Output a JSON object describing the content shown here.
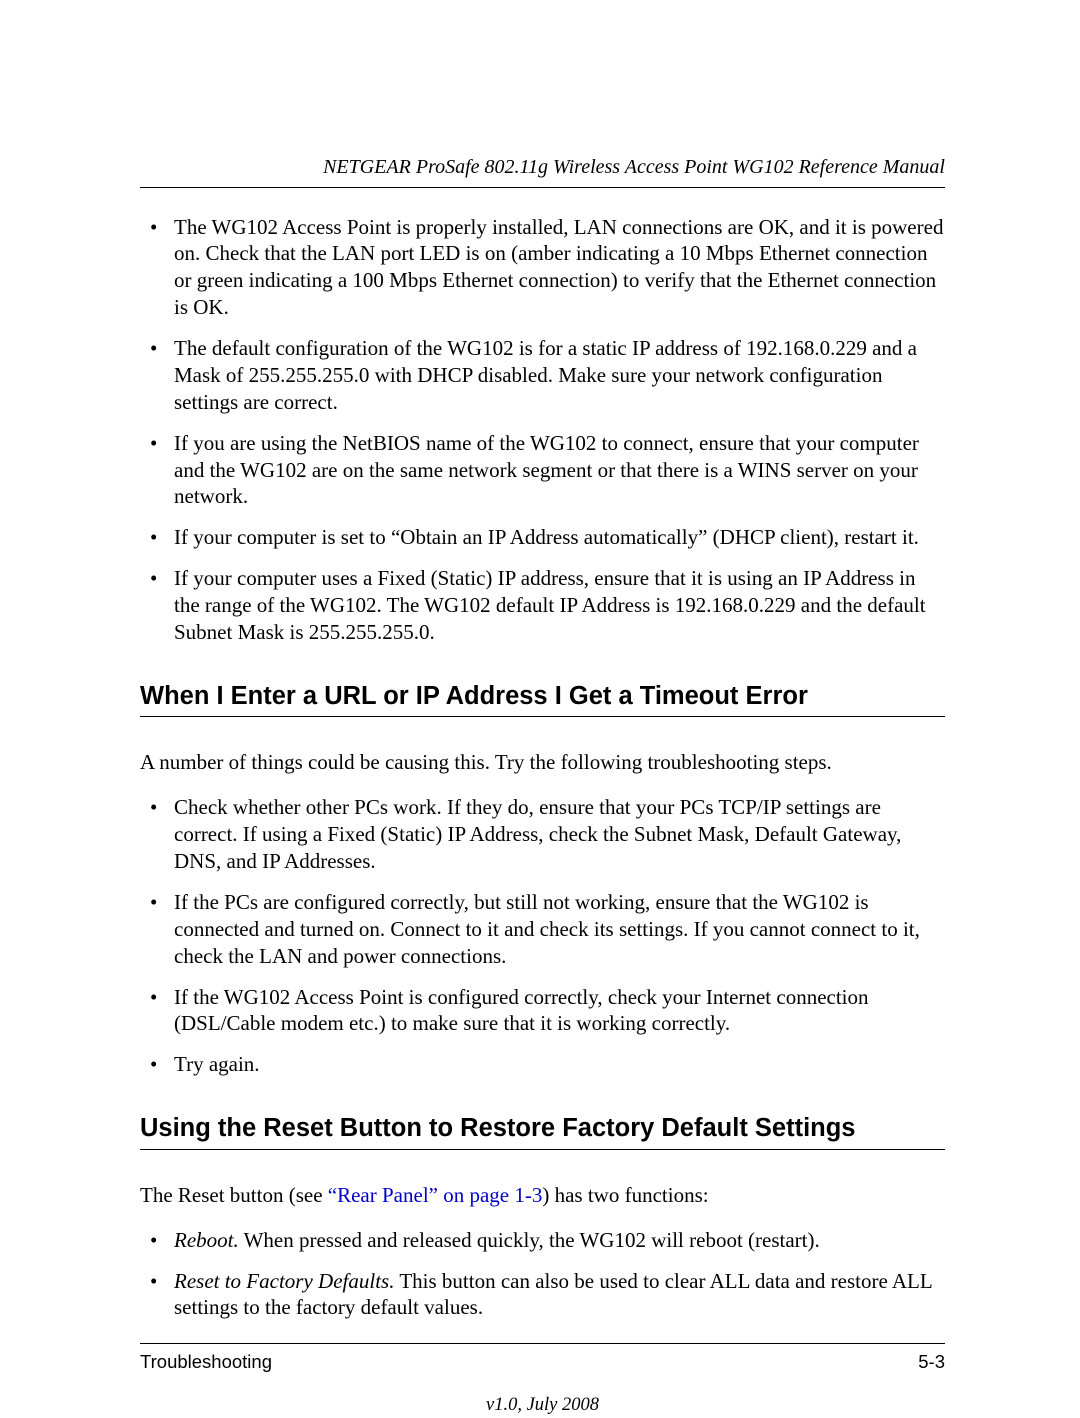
{
  "header": {
    "running_title": "NETGEAR ProSafe 802.11g Wireless Access Point WG102 Reference Manual"
  },
  "bullets_top": [
    "The WG102 Access Point is properly installed, LAN connections are OK, and it is powered on. Check that the LAN port LED is on (amber indicating a 10 Mbps Ethernet connection or green indicating a 100 Mbps Ethernet connection) to verify that the Ethernet connection is OK.",
    "The default configuration of the WG102 is for a static IP address of 192.168.0.229 and a Mask of 255.255.255.0 with DHCP disabled. Make sure your network configuration settings are correct.",
    "If you are using the NetBIOS name of the WG102 to connect, ensure that your computer and the WG102 are on the same network segment or that there is a WINS server on your network.",
    "If your computer is set to “Obtain an IP Address automatically” (DHCP client), restart it.",
    "If your computer uses a Fixed (Static) IP address, ensure that it is using an IP Address in the range of the WG102. The WG102 default IP Address is 192.168.0.229 and the default Subnet Mask is 255.255.255.0."
  ],
  "section1": {
    "heading": "When I Enter a URL or IP Address I Get a Timeout Error",
    "intro": "A number of things could be causing this. Try the following troubleshooting steps.",
    "bullets": [
      "Check whether other PCs work. If they do, ensure that your PCs TCP/IP settings are correct. If using a Fixed (Static) IP Address, check the Subnet Mask, Default Gateway, DNS, and IP Addresses.",
      "If the PCs are configured correctly, but still not working, ensure that the WG102 is connected and turned on. Connect to it and check its settings. If you cannot connect to it, check the LAN and power connections.",
      "If the WG102 Access Point is configured correctly, check your Internet connection (DSL/Cable modem etc.) to make sure that it is working correctly.",
      "Try again."
    ]
  },
  "section2": {
    "heading": "Using the Reset Button to Restore Factory Default Settings",
    "intro_pre": "The Reset button (see ",
    "intro_link": "“Rear Panel” on page 1-3",
    "intro_post": ") has two functions:",
    "bullets": [
      {
        "lead": "Reboot.",
        "rest": " When pressed and released quickly, the WG102 will reboot (restart)."
      },
      {
        "lead": "Reset to Factory Defaults.",
        "rest": " This button can also be used to clear ALL data and restore ALL settings to the factory default values."
      }
    ]
  },
  "footer": {
    "section_label": "Troubleshooting",
    "page_number": "5-3",
    "version": "v1.0, July 2008"
  }
}
